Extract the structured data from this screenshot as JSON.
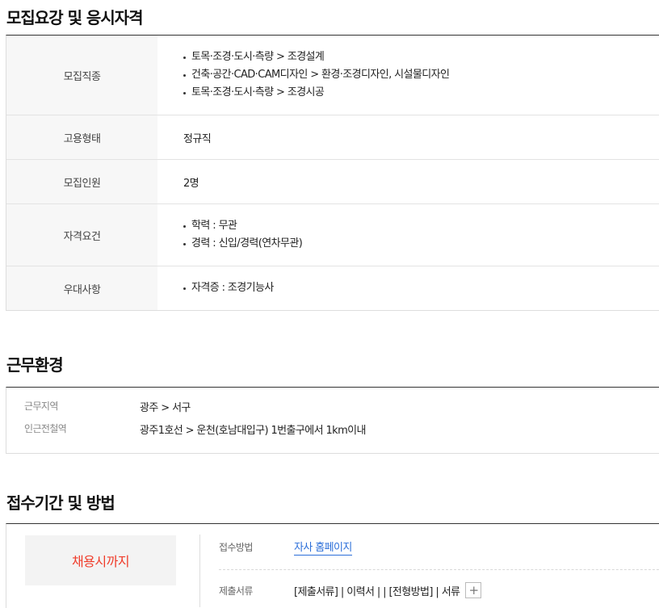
{
  "recruit": {
    "title": "모집요강 및 응시자격",
    "rows": {
      "fields": {
        "label": "모집직종",
        "items": [
          "토목·조경·도시·측량 > 조경설계",
          "건축·공간·CAD·CAM디자인 > 환경·조경디자인, 시설물디자인",
          "토목·조경·도시·측량 > 조경시공"
        ]
      },
      "employment": {
        "label": "고용형태",
        "value": "정규직"
      },
      "headcount": {
        "label": "모집인원",
        "value": "2명"
      },
      "qualification": {
        "label": "자격요건",
        "items": [
          "학력 : 무관",
          "경력 : 신입/경력(연차무관)"
        ]
      },
      "preference": {
        "label": "우대사항",
        "items": [
          "자격증 : 조경기능사"
        ]
      }
    }
  },
  "environment": {
    "title": "근무환경",
    "location": {
      "label": "근무지역",
      "value": "광주 > 서구"
    },
    "subway": {
      "label": "인근전철역",
      "value": "광주1호선 > 운천(호남대입구) 1번출구에서 1km이내"
    }
  },
  "apply": {
    "title": "접수기간 및 방법",
    "deadline": "채용시까지",
    "method": {
      "label": "접수방법",
      "value": "자사 홈페이지"
    },
    "documents": {
      "label": "제출서류",
      "value": "[제출서류] | 이력서 | | [전형방법] | 서류",
      "plus": "+"
    }
  },
  "colors": {
    "deadline": "#f03c2a",
    "link": "#2c6fd9"
  }
}
